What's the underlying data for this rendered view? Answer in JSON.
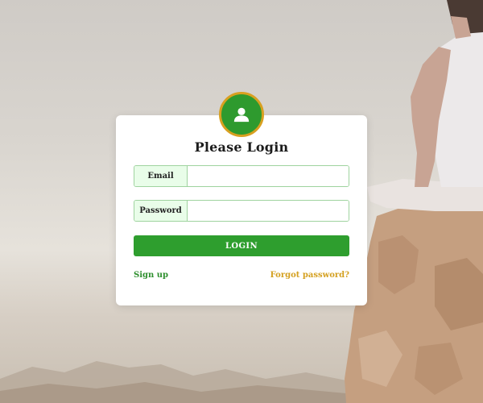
{
  "login": {
    "title": "Please Login",
    "email_label": "Email",
    "email_value": "",
    "password_label": "Password",
    "password_value": "",
    "submit_label": "LOGIN",
    "signup_link": "Sign up",
    "forgot_link": "Forgot password?"
  },
  "icons": {
    "avatar": "user-icon"
  },
  "colors": {
    "accent_green": "#2e9e2e",
    "avatar_border": "#d8a020",
    "forgot_link": "#d4a020",
    "input_border": "#9fd39f",
    "label_bg": "#e9fde9"
  }
}
